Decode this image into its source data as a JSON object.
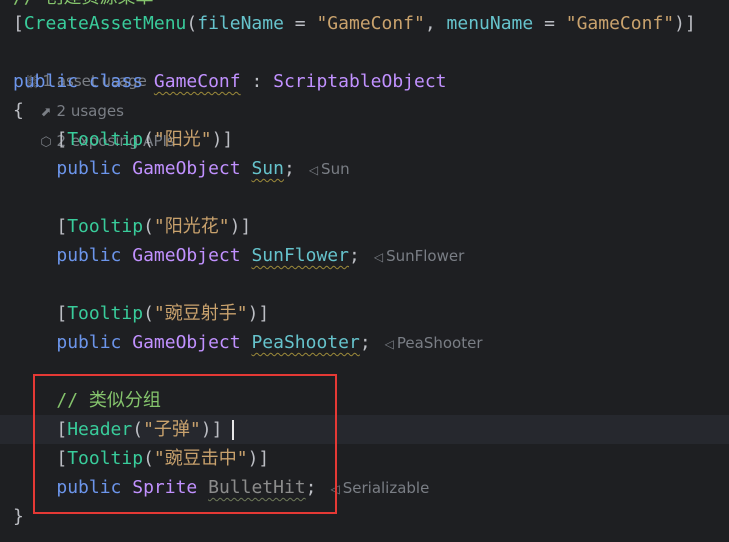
{
  "top_comment": "// 创建资源菜单",
  "line_create": {
    "open": "[",
    "attr": "CreateAssetMenu",
    "p1": "(",
    "param1": "fileName",
    "eq1": " = ",
    "val1": "\"GameConf\"",
    "sep": ", ",
    "param2": "menuName",
    "eq2": " = ",
    "val2": "\"GameConf\"",
    "close": ")]"
  },
  "usage_hints": {
    "asset_usage": "1 asset usage",
    "usages": "2 usages",
    "apis": "2 exposing APIs"
  },
  "class_line": {
    "kw1": "public",
    "kw2": "class",
    "name": "GameConf",
    "colon": " : ",
    "base": "ScriptableObject"
  },
  "brace_open": "{",
  "brace_close": "}",
  "fields": [
    {
      "tooltip": "\"阳光\"",
      "type": "GameObject",
      "name": "Sun",
      "hint": "Sun"
    },
    {
      "tooltip": "\"阳光花\"",
      "type": "GameObject",
      "name": "SunFlower",
      "hint": "SunFlower"
    },
    {
      "tooltip": "\"豌豆射手\"",
      "type": "GameObject",
      "name": "PeaShooter",
      "hint": "PeaShooter"
    }
  ],
  "group_comment": "// 类似分组",
  "header_attr": {
    "name": "Header",
    "value": "\"子弹\""
  },
  "bullet_field": {
    "tooltip": "\"豌豆击中\"",
    "type": "Sprite",
    "name": "BulletHit",
    "hint": "Serializable"
  },
  "tokens": {
    "public": "public",
    "tooltip": "Tooltip",
    "semicolon": ";",
    "lb": "[",
    "lp": "(",
    "rp_rb": ")]"
  },
  "colors": {
    "background": "#1e1f22",
    "keyword": "#6c95eb",
    "type": "#c191ff",
    "attribute": "#39cc9b",
    "string": "#c9a26d",
    "comment": "#85c46c",
    "highlight_box": "#e53935"
  }
}
